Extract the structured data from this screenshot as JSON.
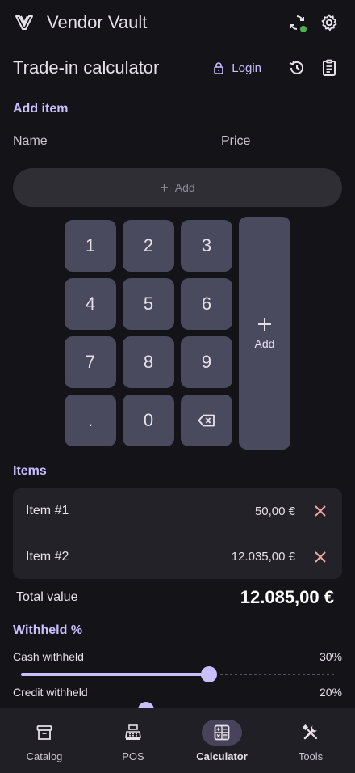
{
  "app": {
    "title": "Vendor Vault"
  },
  "page": {
    "title": "Trade-in calculator",
    "login_label": "Login"
  },
  "add_item": {
    "section_label": "Add item",
    "name_placeholder": "Name",
    "price_placeholder": "Price",
    "add_button_label": "Add"
  },
  "keypad": {
    "keys": [
      "1",
      "2",
      "3",
      "4",
      "5",
      "6",
      "7",
      "8",
      "9",
      ".",
      "0"
    ],
    "add_label": "Add"
  },
  "items": {
    "section_label": "Items",
    "rows": [
      {
        "name": "Item #1",
        "price": "50,00 €"
      },
      {
        "name": "Item #2",
        "price": "12.035,00 €"
      }
    ],
    "total_label": "Total value",
    "total_value": "12.085,00 €"
  },
  "withheld": {
    "section_label": "Withheld %",
    "sliders": [
      {
        "label": "Cash withheld",
        "value_text": "30%",
        "fraction": 0.6
      },
      {
        "label": "Credit withheld",
        "value_text": "20%",
        "fraction": 0.4
      }
    ]
  },
  "nav": {
    "items": [
      {
        "label": "Catalog",
        "icon": "archive-icon",
        "active": false
      },
      {
        "label": "POS",
        "icon": "cash-register-icon",
        "active": false
      },
      {
        "label": "Calculator",
        "icon": "calculator-icon",
        "active": true
      },
      {
        "label": "Tools",
        "icon": "tools-icon",
        "active": false
      }
    ]
  },
  "colors": {
    "accent": "#c9bfff",
    "remove": "#f2a7a7",
    "sync_ok": "#4caf50"
  }
}
